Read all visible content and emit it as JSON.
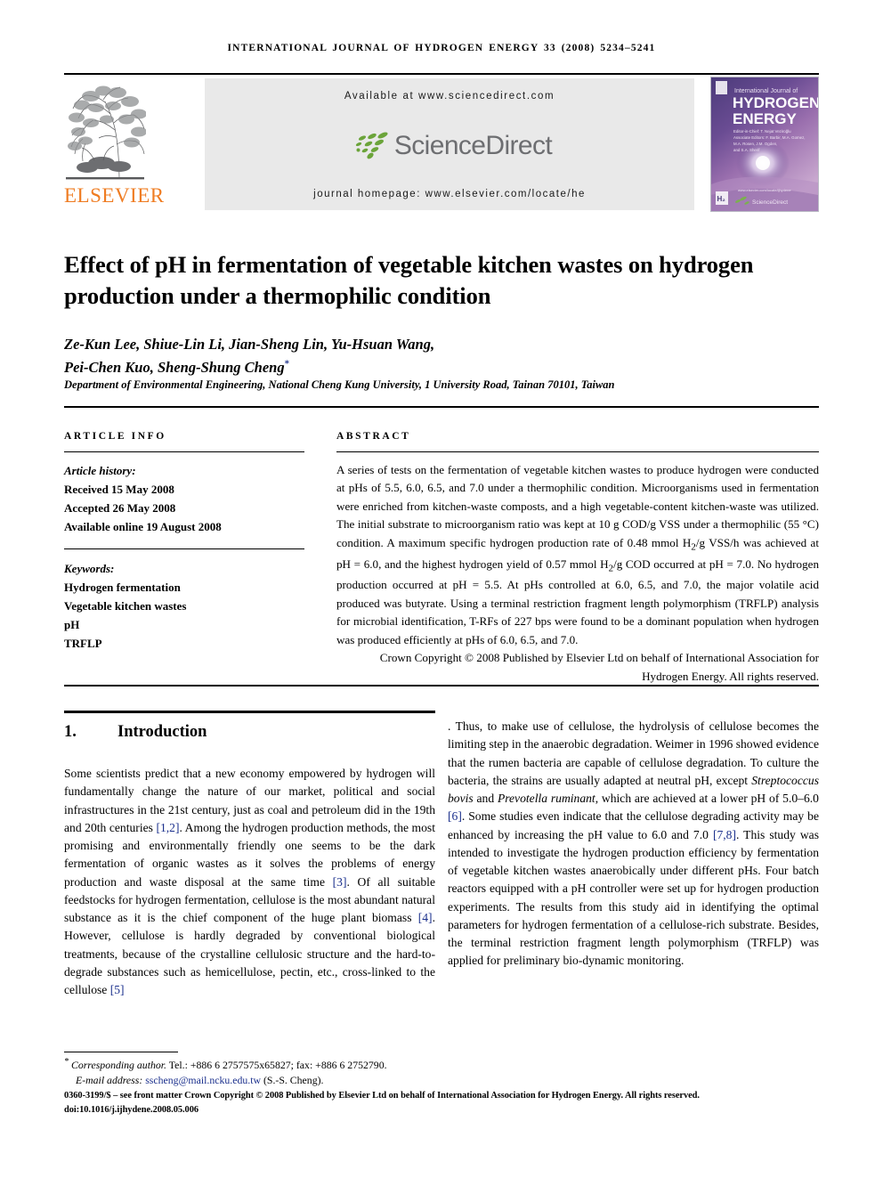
{
  "running_head": "INTERNATIONAL JOURNAL OF HYDROGEN ENERGY 33 (2008) 5234–5241",
  "header": {
    "publisher_name": "ELSEVIER",
    "available_at": "Available at www.sciencedirect.com",
    "sciencedirect_logo_text": "ScienceDirect",
    "journal_homepage": "journal homepage: www.elsevier.com/locate/he",
    "cover": {
      "line_small": "International Journal of",
      "line_1": "HYDROGEN",
      "line_2": "ENERGY",
      "editors_line_1": "Editor-in-Chief: T. Nejat Veziroğlu",
      "editors_line_2": "Associate Editors: F. Barbir, M.A. Gomez,",
      "editors_line_3": "M.A. Rosen, J.M. Ogden,",
      "editors_line_4": "and S.A. Sherif",
      "footer_text": "www.elsevier.com/locate/ijhydene",
      "footer_brand": "ScienceDirect"
    }
  },
  "article": {
    "title": "Effect of pH in fermentation of vegetable kitchen wastes on hydrogen production under a thermophilic condition",
    "authors": "Ze-Kun Lee, Shiue-Lin Li, Jian-Sheng Lin, Yu-Hsuan Wang, Pei-Chen Kuo, Sheng-Shung Cheng",
    "authors_line_1": "Ze-Kun Lee, Shiue-Lin Li, Jian-Sheng Lin, Yu-Hsuan Wang,",
    "authors_line_2": "Pei-Chen Kuo, Sheng-Shung Cheng",
    "corresponding_marker": "*",
    "affiliation": "Department of Environmental Engineering, National Cheng Kung University, 1 University Road, Tainan 70101, Taiwan"
  },
  "article_info": {
    "heading": "ARTICLE INFO",
    "history_label": "Article history:",
    "history": [
      "Received 15 May 2008",
      "Accepted 26 May 2008",
      "Available online 19 August 2008"
    ],
    "keywords_label": "Keywords:",
    "keywords": [
      "Hydrogen fermentation",
      "Vegetable kitchen wastes",
      "pH",
      "TRFLP"
    ]
  },
  "abstract": {
    "heading": "ABSTRACT",
    "body": "A series of tests on the fermentation of vegetable kitchen wastes to produce hydrogen were conducted at pHs of 5.5, 6.0, 6.5, and 7.0 under a thermophilic condition. Microorganisms used in fermentation were enriched from kitchen-waste composts, and a high vegetable-content kitchen-waste was utilized. The initial substrate to microorganism ratio was kept at 10 g COD/g VSS under a thermophilic (55 °C) condition. A maximum specific hydrogen production rate of 0.48 mmol H2/g VSS/h was achieved at pH = 6.0, and the highest hydrogen yield of 0.57 mmol H2/g COD occurred at pH = 7.0. No hydrogen production occurred at pH = 5.5. At pHs controlled at 6.0, 6.5, and 7.0, the major volatile acid produced was butyrate. Using a terminal restriction fragment length polymorphism (TRFLP) analysis for microbial identification, T-RFs of 227 bps were found to be a dominant population when hydrogen was produced efficiently at pHs of 6.0, 6.5, and 7.0.",
    "copyright": "Crown Copyright © 2008 Published by Elsevier Ltd on behalf of International Association for Hydrogen Energy. All rights reserved."
  },
  "section_1": {
    "number": "1.",
    "title": "Introduction",
    "left_paragraph_part1": "Some scientists predict that a new economy empowered by hydrogen will fundamentally change the nature of our market, political and social infrastructures in the 21st century, just as coal and petroleum did in the 19th and 20th centuries ",
    "ref_12": "[1,2]",
    "left_paragraph_part2": ". Among the hydrogen production methods, the most promising and environmentally friendly one seems to be the dark fermentation of organic wastes as it solves the problems of energy production and waste disposal at the same time ",
    "ref_3": "[3]",
    "left_paragraph_part3": ". Of all suitable feedstocks for hydrogen fermentation, cellulose is the most abundant natural substance as it is the chief component of the huge plant biomass ",
    "ref_4": "[4]",
    "left_paragraph_part4": ". However, cellulose is hardly degraded by conventional biological treatments, because of the crystalline cellulosic structure and the hard-to-degrade substances such as hemicellulose, pectin, etc., cross-linked to the cellulose ",
    "ref_5": "[5]",
    "left_paragraph_part5": ". Thus, to make use of cellulose, the hydrolysis of cellulose becomes the limiting step in the anaerobic degradation. Weimer in 1996 showed evidence that the rumen bacteria are capable of cellulose degradation. To culture the bacteria, the strains are usually adapted at neutral pH, except ",
    "italic_1": "Streptococcus bovis",
    "right_paragraph_part1": " and ",
    "italic_2": "Prevotella ruminant",
    "right_paragraph_part2": ", which are achieved at a lower pH of 5.0–6.0 ",
    "ref_6": "[6]",
    "right_paragraph_part3": ". Some studies even indicate that the cellulose degrading activity may be enhanced by increasing the pH value to 6.0 and 7.0 ",
    "ref_78": "[7,8]",
    "right_paragraph_part4": ". This study was intended to investigate the hydrogen production efficiency by fermentation of vegetable kitchen wastes anaerobically under different pHs. Four batch reactors equipped with a pH controller were set up for hydrogen production experiments. The results from this study aid in identifying the optimal parameters for hydrogen fermentation of a cellulose-rich substrate. Besides, the terminal restriction fragment length polymorphism (TRFLP) was applied for preliminary bio-dynamic monitoring."
  },
  "footnotes": {
    "corresponding_label": "Corresponding author.",
    "corresponding_contact": " Tel.: +886 6 2757575x65827; fax: +886 6 2752790.",
    "email_label": "E-mail address:",
    "email": "sscheng@mail.ncku.edu.tw",
    "email_owner": "(S.-S. Cheng).",
    "imprint_line_1": "0360-3199/$ – see front matter Crown Copyright © 2008 Published by Elsevier Ltd on behalf of International Association for Hydrogen Energy. All rights reserved.",
    "imprint_line_2": "doi:10.1016/j.ijhydene.2008.05.006"
  },
  "colors": {
    "elsevier_orange": "#ef7c22",
    "sciencedirect_green": "#6ba43a",
    "sciencedirect_gray": "#6d6e71",
    "banner_gray": "#e9e9e9",
    "reference_blue": "#1a2f8c",
    "cover_purple": "#6a4c93"
  }
}
